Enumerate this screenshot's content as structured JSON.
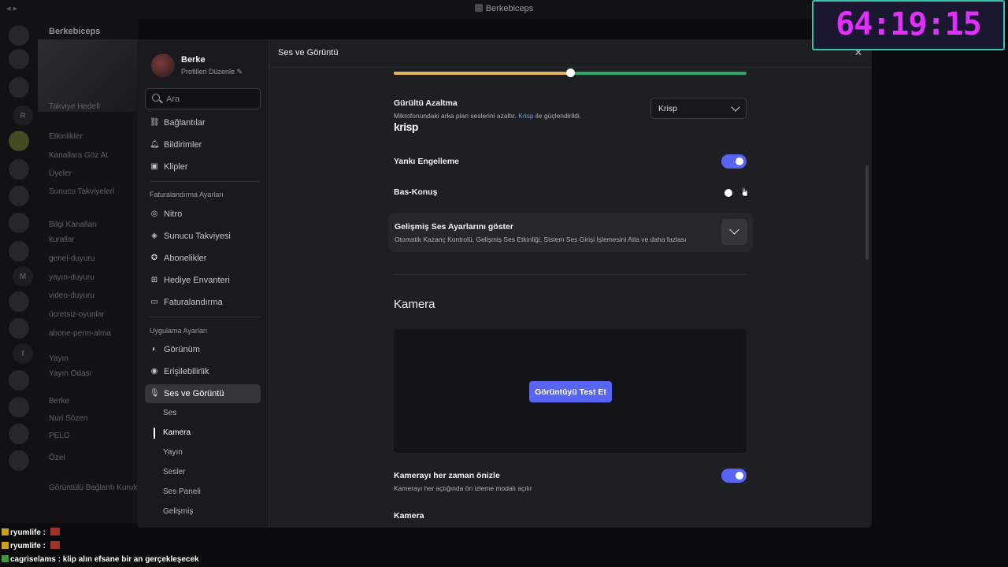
{
  "window": {
    "title": "Berkebiceps"
  },
  "background": {
    "server_name": "Berkebiceps",
    "channels": [
      "Takviye Hedefi",
      "Etkinlikler",
      "Kanallara Göz At",
      "Üyeler",
      "Sunucu Takviyeleri",
      "Bilgi Kanalları",
      "kurallar",
      "genel-duyuru",
      "yayın-duyuru",
      "video-duyuru",
      "ücretsiz-oyunlar",
      "abone-perm-alma",
      "Yayın",
      "Yayın Odası",
      "Berke",
      "Nuri Sözen",
      "PELO",
      "Özel",
      "Görüntülü Bağlantı Kuruldu"
    ]
  },
  "profile": {
    "name": "Berke",
    "edit_label": "Profilleri Düzenle"
  },
  "search": {
    "placeholder": "Ara"
  },
  "sidebar": {
    "top_items": [
      {
        "label": "Bağlantılar",
        "icon": "link-icon"
      },
      {
        "label": "Bildirimler",
        "icon": "bell-icon"
      },
      {
        "label": "Klipler",
        "icon": "clip-icon"
      }
    ],
    "billing_header": "Faturalandırma Ayarları",
    "billing_items": [
      {
        "label": "Nitro",
        "icon": "nitro-icon"
      },
      {
        "label": "Sunucu Takviyesi",
        "icon": "boost-icon"
      },
      {
        "label": "Abonelikler",
        "icon": "subscriptions-icon"
      },
      {
        "label": "Hediye Envanteri",
        "icon": "gift-icon"
      },
      {
        "label": "Faturalandırma",
        "icon": "card-icon"
      }
    ],
    "app_header": "Uygulama Ayarları",
    "app_items": [
      {
        "label": "Görünüm",
        "icon": "palette-icon"
      },
      {
        "label": "Erişilebilirlik",
        "icon": "accessibility-icon"
      },
      {
        "label": "Ses ve Görüntü",
        "icon": "microphone-icon"
      }
    ],
    "sub_items": [
      "Ses",
      "Kamera",
      "Yayın",
      "Sesler",
      "Ses Paneli",
      "Gelişmiş"
    ]
  },
  "content": {
    "header": "Ses ve Görüntü",
    "input_sensitivity": {
      "value": 0.5
    },
    "noise": {
      "label": "Gürültü Azaltma",
      "desc_before": "Mikrofonundaki arka plan seslerini azaltır.",
      "desc_link": "Krisp",
      "desc_after": "ile güçlendirildi.",
      "logo_text": "krisp",
      "selected": "Krisp"
    },
    "echo": {
      "label": "Yankı Engelleme",
      "enabled": true
    },
    "ptt": {
      "label": "Bas-Konuş",
      "enabled": false
    },
    "advanced": {
      "label": "Gelişmiş Ses Ayarlarını göster",
      "desc": "Otomatik Kazanç Kontrolü, Gelişmiş Ses Etkinliği, Sistem Ses Girişi İşlemesini Atla ve daha fazlası"
    },
    "camera_title": "Kamera",
    "test_button": "Görüntüyü Test Et",
    "always_preview": {
      "label": "Kamerayı her zaman önizle",
      "desc": "Kamerayı her açtığında ön izleme modalı açılır",
      "enabled": true
    },
    "camera_select_label": "Kamera"
  },
  "timer": {
    "value": "64:19:15"
  },
  "chat": [
    {
      "user": "ryumlife",
      "text": ""
    },
    {
      "user": "ryumlife",
      "text": ""
    },
    {
      "user": "cagriselams",
      "text": "klip alın efsane bir an gerçekleşecek"
    }
  ]
}
